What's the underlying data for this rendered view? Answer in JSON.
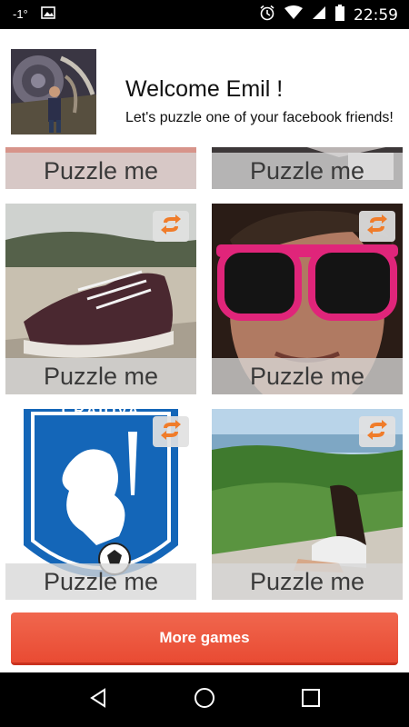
{
  "status_bar": {
    "signal_text": "-1°",
    "time": "22:59",
    "icons": [
      "image-icon",
      "alarm-icon",
      "wifi-icon",
      "cell-signal-icon",
      "battery-icon"
    ]
  },
  "header": {
    "title": "Welcome Emil !",
    "subtitle": "Let's puzzle one of your facebook friends!"
  },
  "tiles": [
    {
      "label": "Puzzle me",
      "subject": "partial-top-left"
    },
    {
      "label": "Puzzle me",
      "subject": "partial-top-right"
    },
    {
      "label": "Puzzle me",
      "subject": "sneaker-on-sand"
    },
    {
      "label": "Puzzle me",
      "subject": "man-with-pink-sunglasses"
    },
    {
      "label": "Puzzle me",
      "subject": "craiova-lion-crest"
    },
    {
      "label": "Puzzle me",
      "subject": "woman-on-hill-landscape"
    }
  ],
  "crest_text": "CRAIOVA",
  "more_games": {
    "label": "More games"
  },
  "nav": {
    "buttons": [
      "back-icon",
      "home-icon",
      "recents-icon"
    ]
  },
  "colors": {
    "accent": "#ef5b41",
    "swap_icon": "#f07c2a",
    "label_band": "#d7d7d7"
  }
}
